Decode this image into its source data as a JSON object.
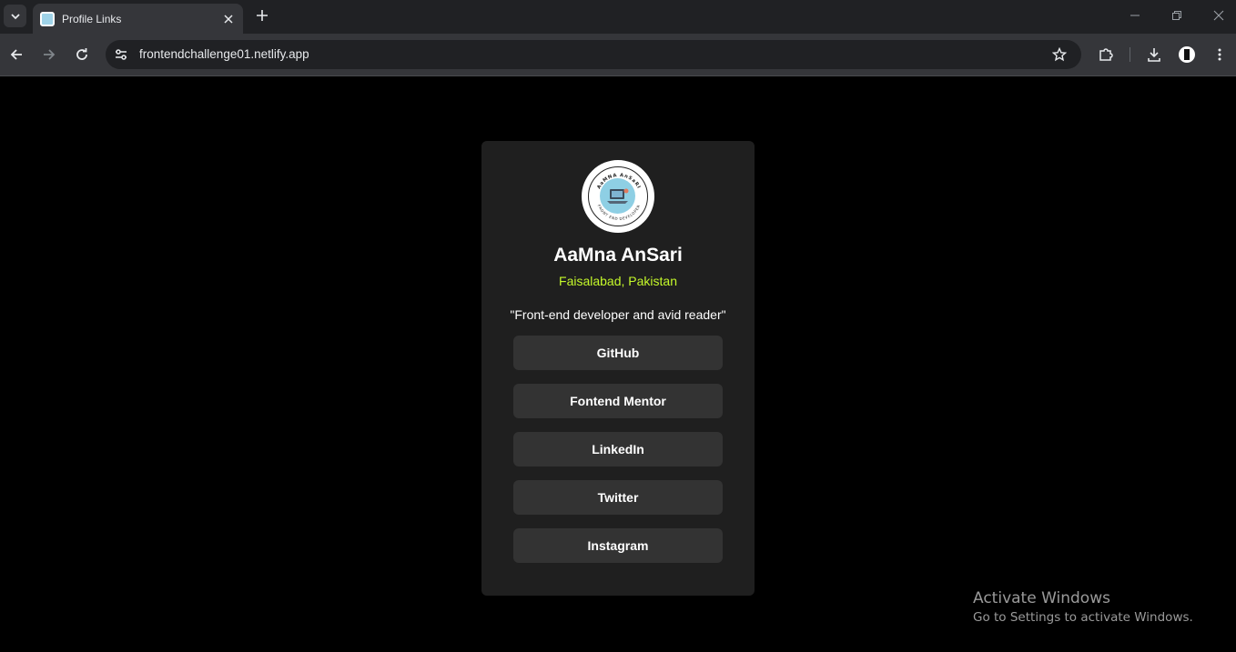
{
  "browser": {
    "tab_title": "Profile Links",
    "url": "frontendchallenge01.netlify.app"
  },
  "profile": {
    "avatar_text_top": "AaMNA AnSaRI",
    "avatar_text_bottom": "FRONT END DEVELOPER",
    "name": "AaMna AnSari",
    "location": "Faisalabad, Pakistan",
    "bio": "\"Front-end developer and avid reader\"",
    "links": [
      {
        "label": "GitHub"
      },
      {
        "label": "Fontend Mentor"
      },
      {
        "label": "LinkedIn"
      },
      {
        "label": "Twitter"
      },
      {
        "label": "Instagram"
      }
    ]
  },
  "watermark": {
    "title": "Activate Windows",
    "subtitle": "Go to Settings to activate Windows."
  },
  "colors": {
    "accent": "#c4f82a",
    "card_bg": "#1f1f1f",
    "button_bg": "#333333",
    "page_bg": "#000000"
  }
}
